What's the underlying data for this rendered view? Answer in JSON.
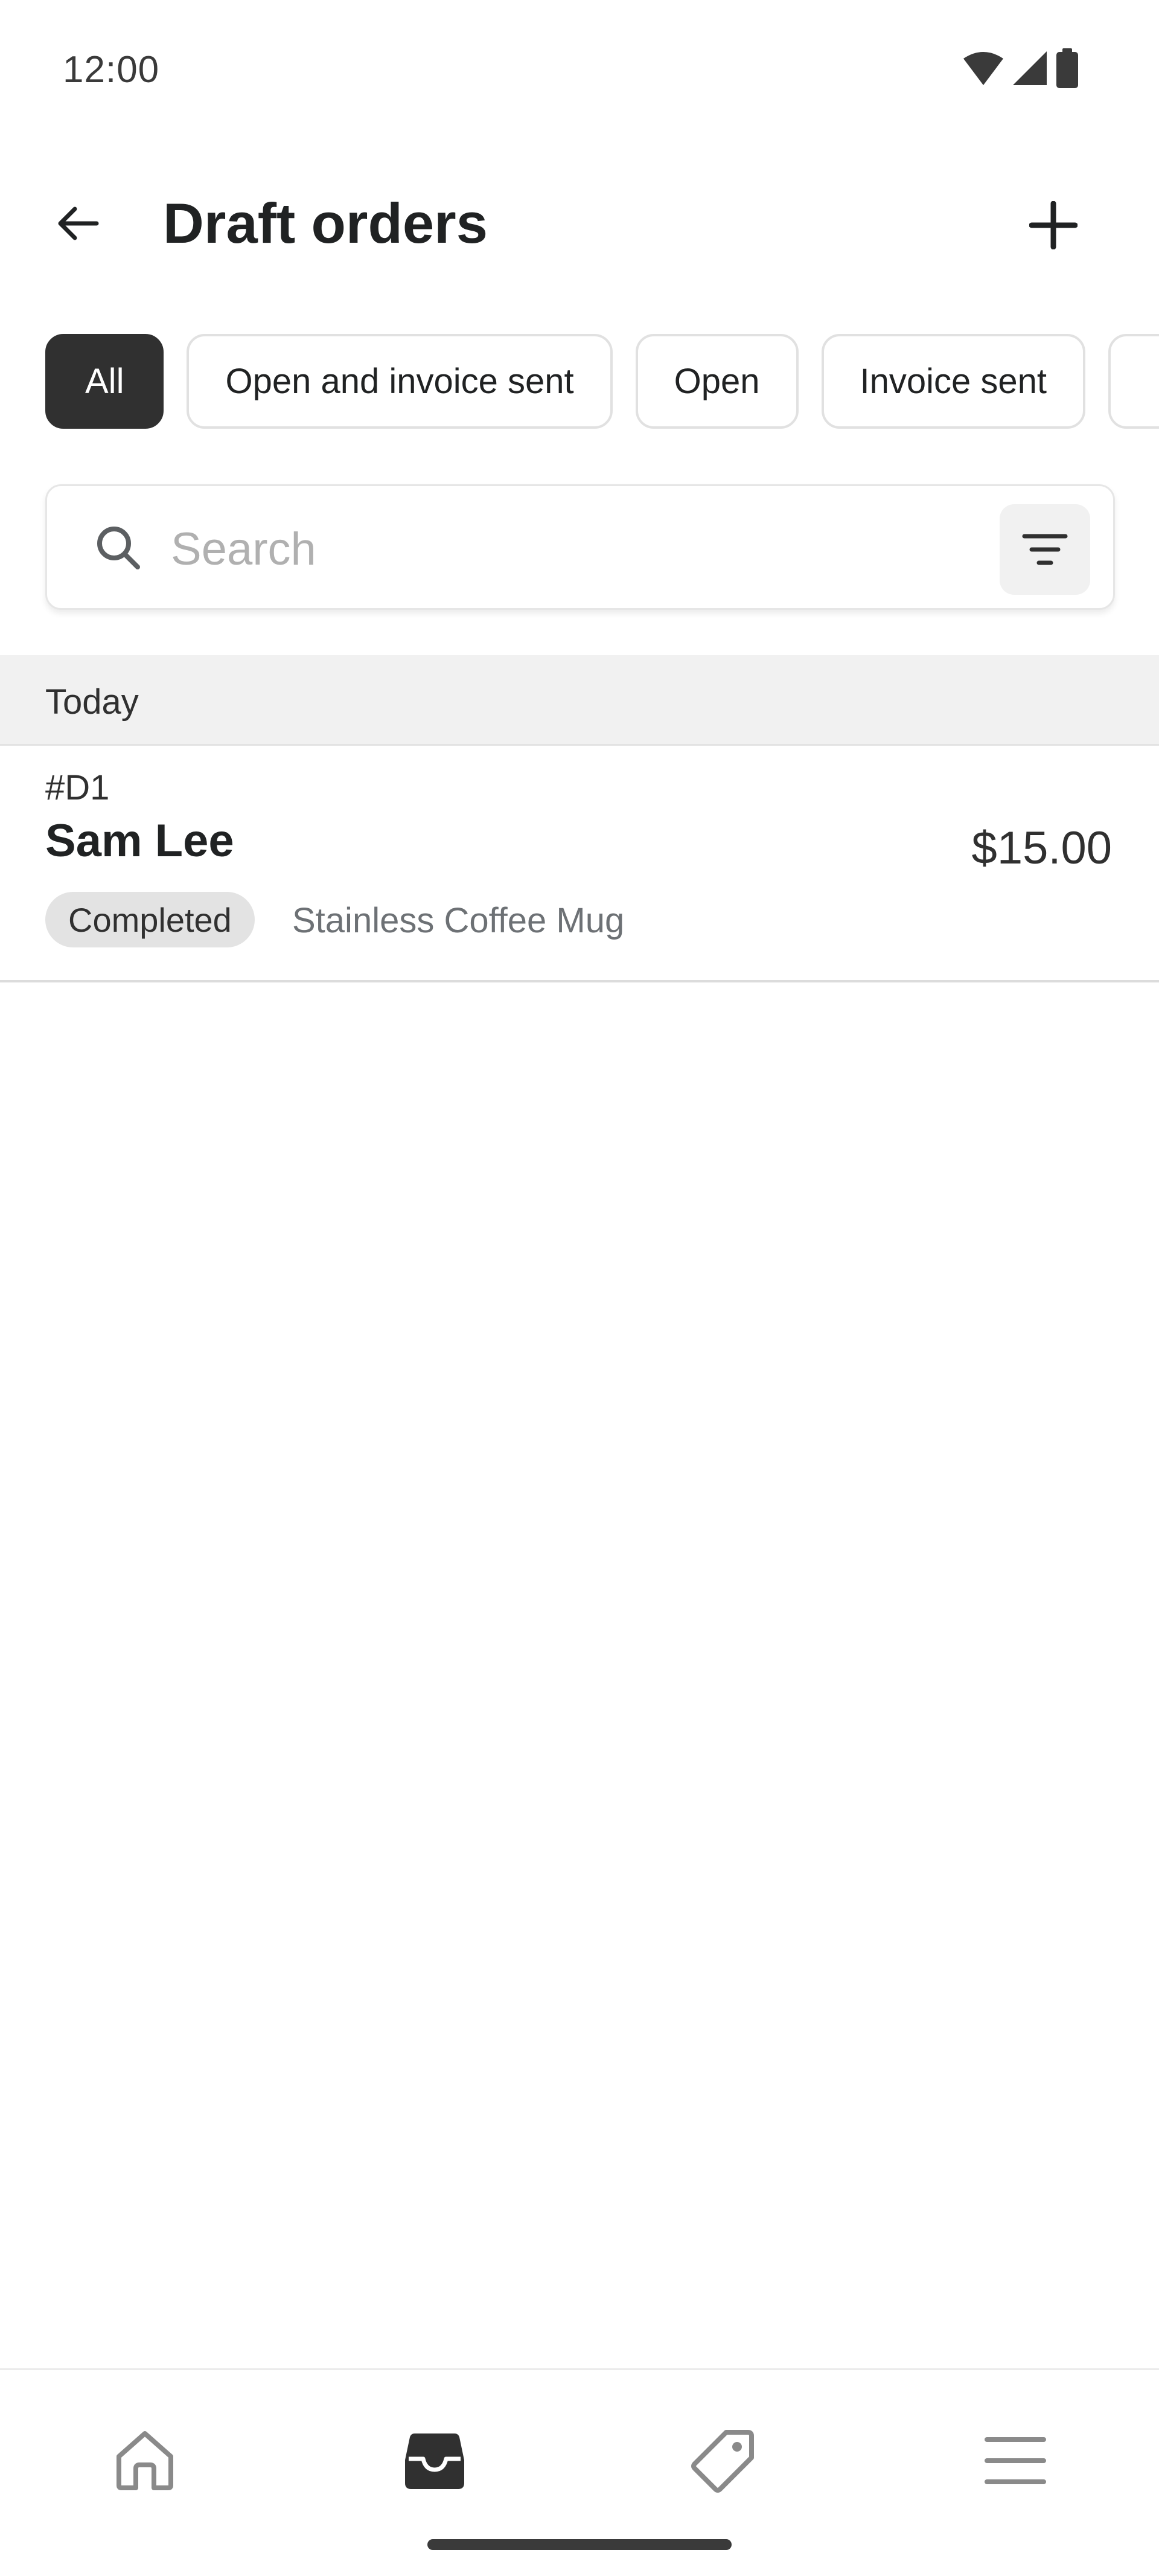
{
  "status_bar": {
    "time": "12:00",
    "icons": [
      "wifi-icon",
      "cellular-icon",
      "battery-icon"
    ]
  },
  "header": {
    "title": "Draft orders",
    "back_icon": "arrow-left-icon",
    "add_icon": "plus-icon"
  },
  "filters": {
    "chips": [
      {
        "label": "All",
        "selected": true
      },
      {
        "label": "Open and invoice sent",
        "selected": false
      },
      {
        "label": "Open",
        "selected": false
      },
      {
        "label": "Invoice sent",
        "selected": false
      }
    ]
  },
  "search": {
    "placeholder": "Search",
    "value": "",
    "icon": "search-icon",
    "filter_icon": "filter-lines-icon"
  },
  "sections": [
    {
      "label": "Today",
      "orders": [
        {
          "number": "#D1",
          "customer": "Sam Lee",
          "total": "$15.00",
          "status": "Completed",
          "items": "Stainless Coffee Mug"
        }
      ]
    }
  ],
  "bottom_nav": {
    "items": [
      {
        "name": "home",
        "icon": "home-icon",
        "active": false
      },
      {
        "name": "orders",
        "icon": "inbox-icon",
        "active": true
      },
      {
        "name": "products",
        "icon": "tag-icon",
        "active": false
      },
      {
        "name": "menu",
        "icon": "menu-icon",
        "active": false
      }
    ]
  },
  "colors": {
    "selected_chip": "#303030",
    "section_bg": "#f1f1f1",
    "badge_bg": "#e3e3e3",
    "text_primary": "#202223",
    "text_secondary": "#6d7175"
  }
}
